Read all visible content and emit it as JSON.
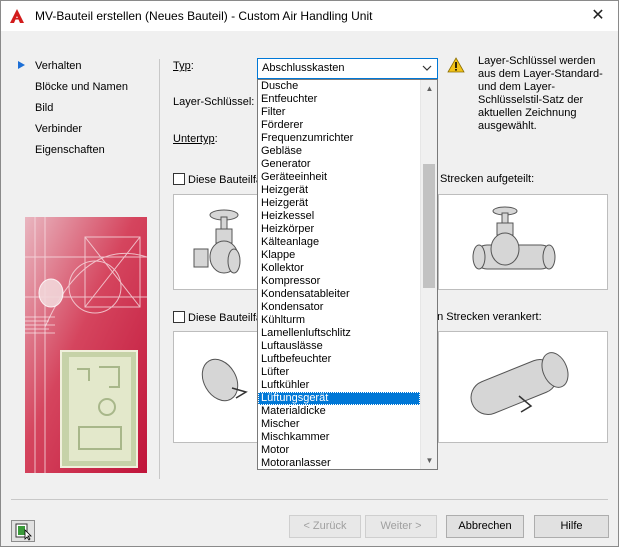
{
  "window": {
    "title": "MV-Bauteil erstellen (Neues Bauteil) - Custom Air Handling Unit",
    "close": "✕"
  },
  "nav": {
    "items": [
      {
        "label": "Verhalten",
        "active": true
      },
      {
        "label": "Blöcke und Namen",
        "active": false
      },
      {
        "label": "Bild",
        "active": false
      },
      {
        "label": "Verbinder",
        "active": false
      },
      {
        "label": "Eigenschaften",
        "active": false
      }
    ]
  },
  "form": {
    "typ_label": "Typ",
    "typ_label_suffix": ":",
    "typ_value": "Abschlusskasten",
    "layer_label": "Layer-Schlüssel:",
    "untertyp_label": "Untertyp",
    "untertyp_label_suffix": ":",
    "note": "Layer-Schlüssel werden aus dem Layer-Standard- und dem Layer-Schlüsselstil-Satz der aktuellen Zeichnung ausgewählt.",
    "check1_label_start": "Diese Bauteilfa",
    "check1_label_end": "Strecken aufgeteilt:",
    "check2_label_start": "Diese Bauteilfa",
    "check2_label_end": "en Strecken verankert:"
  },
  "dropdown": {
    "options": [
      "Dusche",
      "Entfeuchter",
      "Filter",
      "Förderer",
      "Frequenzumrichter",
      "Gebläse",
      "Generator",
      "Geräteeinheit",
      "Heizgerät",
      "Heizgerät",
      "Heizkessel",
      "Heizkörper",
      "Kälteanlage",
      "Klappe",
      "Kollektor",
      "Kompressor",
      "Kondensatableiter",
      "Kondensator",
      "Kühlturm",
      "Lamellenluftschlitz",
      "Luftauslässe",
      "Luftbefeuchter",
      "Lüfter",
      "Luftkühler",
      "Lüftungsgerät",
      "Materialdicke",
      "Mischer",
      "Mischkammer",
      "Motor",
      "Motoranlasser"
    ],
    "selected": "Lüftungsgerät",
    "scroll_up": "▲",
    "scroll_down": "▼"
  },
  "buttons": {
    "back": "< Zurück",
    "next": "Weiter >",
    "cancel": "Abbrechen",
    "help": "Hilfe"
  },
  "colors": {
    "accent": "#0078d7",
    "nav_marker": "#1d6fd6",
    "warning": "#f2c318"
  }
}
